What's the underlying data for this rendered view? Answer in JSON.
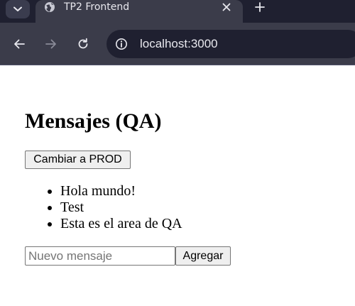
{
  "browser": {
    "tab_title": "TP2 Frontend",
    "url": "localhost:3000",
    "icons": {
      "tab_search": "chevron-down-icon",
      "favicon": "globe-icon",
      "tab_close": "close-icon",
      "new_tab": "plus-icon",
      "back": "back-arrow-icon",
      "forward": "forward-arrow-icon",
      "reload": "reload-icon",
      "site_info": "info-icon"
    },
    "colors": {
      "tabstrip": "#1f2030",
      "toolbar": "#3b3c4a",
      "omnibox": "#1f2030"
    }
  },
  "page": {
    "title": "Mensajes (QA)",
    "switch_button_label": "Cambiar a PROD",
    "messages": [
      "Hola mundo!",
      "Test",
      "Esta es el area de QA"
    ],
    "new_message_placeholder": "Nuevo mensaje",
    "new_message_value": "",
    "add_button_label": "Agregar"
  }
}
